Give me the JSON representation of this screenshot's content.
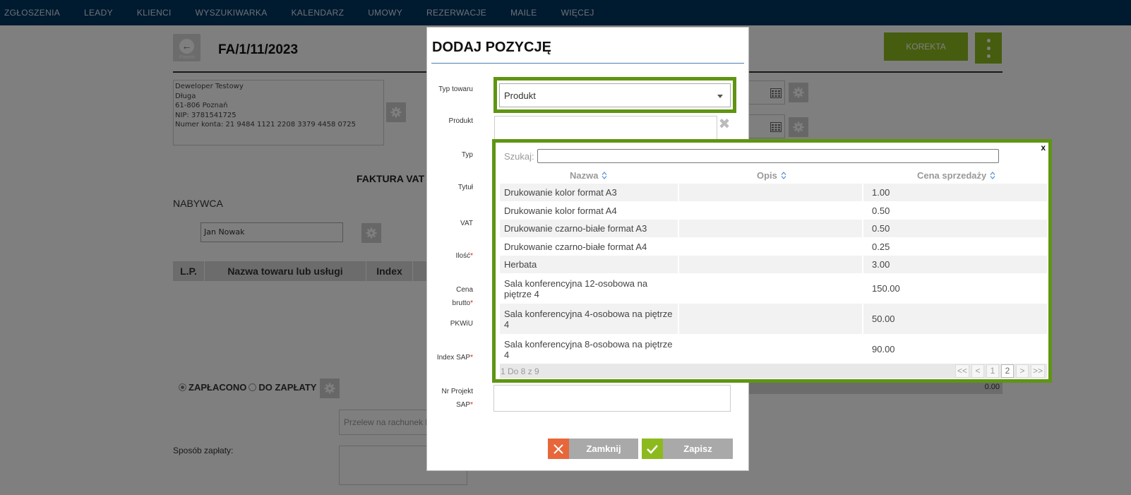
{
  "nav": {
    "items": [
      "ZGŁOSZENIA",
      "LEADY",
      "KLIENCI",
      "WYSZUKIWARKA",
      "KALENDARZ",
      "UMOWY",
      "REZERWACJE",
      "MAILE",
      "WIĘCEJ"
    ]
  },
  "invoice": {
    "back_label": "Powrót",
    "number": "FA/1/11/2023",
    "korekta_label": "KOREKTA",
    "seller_lines": [
      "Deweloper Testowy",
      "Długa",
      "61-806 Poznań",
      "NIP: 3781541725",
      "Numer konta: 21 9484 1121 2208 3379 4458 0725"
    ],
    "doc_title": "FAKTURA VAT",
    "buyer_heading": "NABYWCA",
    "buyer_value": "Jan Nowak",
    "table_headers": [
      "L.P.",
      "Nazwa towaru lub usługi",
      "Index"
    ],
    "paid_label": "ZAPŁACONO",
    "to_pay_label": "DO ZAPŁATY",
    "sum_value": "0.00",
    "przelew_placeholder": "Przelew na rachunek b",
    "sposob_label": "Sposób zapłaty:"
  },
  "modal": {
    "title": "DODAJ POZYCJĘ",
    "labels": {
      "typ_towaru": "Typ towaru",
      "produkt": "Produkt",
      "typ": "Typ",
      "tytul": "Tytuł",
      "vat": "VAT",
      "ilosc": "Ilość",
      "cena_1": "Cena",
      "cena_2": "brutto",
      "pkwiu": "PKWiU",
      "index_sap": "Index SAP",
      "nr_projekt_1": "Nr Projekt",
      "nr_projekt_2": "SAP"
    },
    "required_mark": "*",
    "typ_towaru_value": "Produkt",
    "close_label": "Zamknij",
    "save_label": "Zapisz"
  },
  "popup": {
    "close": "x",
    "search_label": "Szukaj:",
    "columns": [
      "Nazwa",
      "Opis",
      "Cena sprzedaży"
    ],
    "rows": [
      {
        "nazwa": "Drukowanie kolor format A3",
        "opis": "",
        "cena": "1.00"
      },
      {
        "nazwa": "Drukowanie kolor format A4",
        "opis": "",
        "cena": "0.50"
      },
      {
        "nazwa": "Drukowanie czarno-białe format A3",
        "opis": "",
        "cena": "0.50"
      },
      {
        "nazwa": "Drukowanie czarno-białe format A4",
        "opis": "",
        "cena": "0.25"
      },
      {
        "nazwa": "Herbata",
        "opis": "",
        "cena": "3.00"
      },
      {
        "nazwa": "Sala konferencyjna 12-osobowa na piętrze 4",
        "opis": "",
        "cena": "150.00"
      },
      {
        "nazwa": "Sala konferencyjna 4-osobowa na piętrze 4",
        "opis": "",
        "cena": "50.00"
      },
      {
        "nazwa": "Sala konferencyjna 8-osobowa na piętrze 4",
        "opis": "",
        "cena": "90.00"
      }
    ],
    "footer_info": "1 Do 8 z 9",
    "pager": [
      "<<",
      "<",
      "1",
      "2",
      ">",
      ">>"
    ],
    "current_page": "2"
  },
  "colors": {
    "nav_bg": "#003560",
    "accent_green": "#8cba1e",
    "highlight_border": "#5f9512",
    "close_btn": "#e8673a",
    "save_btn": "#8cba1e"
  },
  "icons": [
    "back-arrow-icon",
    "gear-icon",
    "calendar-icon",
    "chevron-down-icon",
    "clear-icon",
    "sort-icon",
    "close-x-icon",
    "check-icon"
  ]
}
